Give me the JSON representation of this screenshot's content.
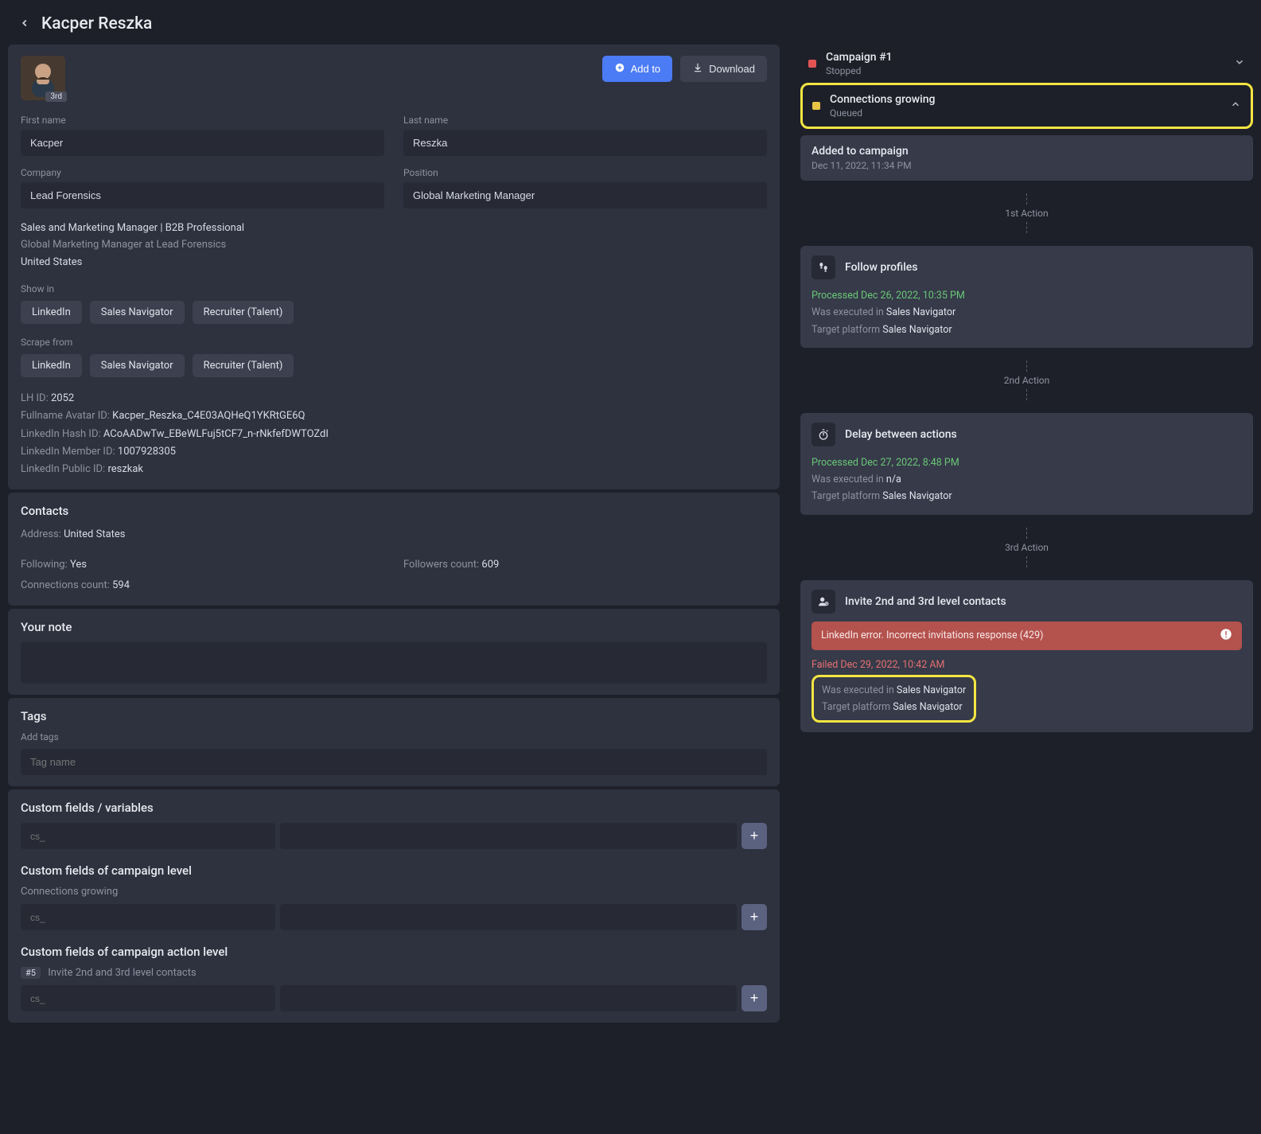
{
  "header": {
    "title": "Kacper Reszka"
  },
  "profile": {
    "degree_badge": "3rd",
    "add_to_label": "Add to",
    "download_label": "Download",
    "fields": {
      "first_name_label": "First name",
      "first_name": "Kacper",
      "last_name_label": "Last name",
      "last_name": "Reszka",
      "company_label": "Company",
      "company": "Lead Forensics",
      "position_label": "Position",
      "position": "Global Marketing Manager"
    },
    "headline": "Sales and Marketing Manager | B2B Professional",
    "subline": "Global Marketing Manager at Lead Forensics",
    "location": "United States",
    "show_in": {
      "label": "Show in",
      "options": [
        "LinkedIn",
        "Sales Navigator",
        "Recruiter (Talent)"
      ]
    },
    "scrape_from": {
      "label": "Scrape from",
      "options": [
        "LinkedIn",
        "Sales Navigator",
        "Recruiter (Talent)"
      ]
    },
    "ids": {
      "lh_id_label": "LH ID:",
      "lh_id": "2052",
      "fullname_avatar_label": "Fullname Avatar ID:",
      "fullname_avatar": "Kacper_Reszka_C4E03AQHeQ1YKRtGE6Q",
      "hash_label": "LinkedIn Hash ID:",
      "hash": "ACoAADwTw_EBeWLFuj5tCF7_n-rNkfefDWTOZdI",
      "member_label": "LinkedIn Member ID:",
      "member": "1007928305",
      "public_label": "LinkedIn Public ID:",
      "public": "reszkak"
    }
  },
  "contacts": {
    "title": "Contacts",
    "address_label": "Address:",
    "address": "United States",
    "following_label": "Following:",
    "following": "Yes",
    "followers_label": "Followers count:",
    "followers": "609",
    "connections_label": "Connections count:",
    "connections": "594"
  },
  "note": {
    "title": "Your note"
  },
  "tags": {
    "title": "Tags",
    "add_label": "Add tags",
    "placeholder": "Tag name"
  },
  "custom_fields": {
    "title": "Custom fields / variables",
    "key_placeholder": "cs_"
  },
  "custom_fields_campaign": {
    "title": "Custom fields of campaign level",
    "sub": "Connections growing",
    "key_placeholder": "cs_"
  },
  "custom_fields_action": {
    "title": "Custom fields of campaign action level",
    "badge": "#5",
    "sub": "Invite 2nd and 3rd level contacts",
    "key_placeholder": "cs_"
  },
  "campaigns": [
    {
      "name": "Campaign #1",
      "status": "Stopped",
      "color": "red",
      "expanded": false
    },
    {
      "name": "Connections growing",
      "status": "Queued",
      "color": "yellow",
      "expanded": true,
      "highlighted": true
    }
  ],
  "timeline": {
    "added": {
      "title": "Added to campaign",
      "date": "Dec 11, 2022, 11:34 PM"
    },
    "first_label": "1st Action",
    "action1": {
      "title": "Follow profiles",
      "processed_prefix": "Processed ",
      "processed_date": "Dec 26, 2022, 10:35 PM",
      "executed_prefix": "Was executed in ",
      "executed_in": "Sales Navigator",
      "target_prefix": "Target platform ",
      "target": "Sales Navigator"
    },
    "second_label": "2nd Action",
    "action2": {
      "title": "Delay between actions",
      "processed_prefix": "Processed ",
      "processed_date": "Dec 27, 2022, 8:48 PM",
      "executed_prefix": "Was executed in ",
      "executed_in": "n/a",
      "target_prefix": "Target platform ",
      "target": "Sales Navigator"
    },
    "third_label": "3rd Action",
    "action3": {
      "title": "Invite 2nd and 3rd level contacts",
      "error_text": "LinkedIn error. Incorrect invitations response",
      "error_code": "(429)",
      "failed_prefix": "Failed ",
      "failed_date": "Dec 29, 2022, 10:42 AM",
      "executed_prefix": "Was executed in ",
      "executed_in": "Sales Navigator",
      "target_prefix": "Target platform ",
      "target": "Sales Navigator"
    }
  }
}
